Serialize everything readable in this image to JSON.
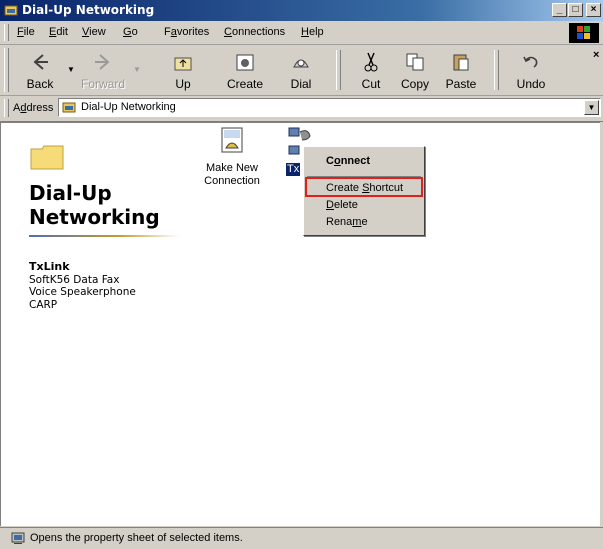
{
  "window": {
    "title": "Dial-Up Networking"
  },
  "title_buttons": {
    "minimize": "_",
    "maximize": "□",
    "close": "×"
  },
  "menubar": {
    "items": [
      {
        "label": "File",
        "accel": "F",
        "rest": "ile"
      },
      {
        "label": "Edit",
        "accel": "E",
        "rest": "dit"
      },
      {
        "label": "View",
        "accel": "V",
        "rest": "iew"
      },
      {
        "label": "Go",
        "accel": "G",
        "rest": "o"
      },
      {
        "label": "Favorites",
        "pre": "F",
        "accel": "a",
        "rest": "vorites"
      },
      {
        "label": "Connections",
        "accel": "C",
        "rest": "onnections"
      },
      {
        "label": "Help",
        "accel": "H",
        "rest": "elp"
      }
    ]
  },
  "toolbar": {
    "buttons": [
      {
        "label": "Back",
        "icon": "back-arrow-icon"
      },
      {
        "label": "Forward",
        "icon": "forward-arrow-icon"
      },
      {
        "label": "Up",
        "icon": "up-folder-icon"
      },
      {
        "label": "Create",
        "icon": "create-connection-icon"
      },
      {
        "label": "Dial",
        "icon": "dial-phone-icon"
      },
      {
        "label": "Cut",
        "icon": "scissors-icon"
      },
      {
        "label": "Copy",
        "icon": "copy-icon"
      },
      {
        "label": "Paste",
        "icon": "paste-icon"
      },
      {
        "label": "Undo",
        "icon": "undo-icon"
      }
    ],
    "close": "×"
  },
  "address": {
    "label_pre": "A",
    "label_accel": "d",
    "label_rest": "dress",
    "value": "Dial-Up Networking",
    "dropdown": "▼"
  },
  "left_panel": {
    "title_line1": "Dial-Up",
    "title_line2": "Networking",
    "details": {
      "name": "TxLink",
      "lines": [
        "SoftK56 Data Fax",
        "Voice Speakerphone",
        "CARP"
      ]
    }
  },
  "items": [
    {
      "label_line1": "Make New",
      "label_line2": "Connection",
      "icon": "make-new-connection-icon"
    },
    {
      "label": "Tx",
      "icon": "connection-computers-icon"
    }
  ],
  "context_menu": {
    "items": [
      {
        "label": "Connect",
        "accel": "o",
        "pre": "C",
        "rest": "nnect"
      },
      {
        "label": "Create Shortcut",
        "pre": "Create ",
        "accel": "S",
        "rest": "hortcut"
      },
      {
        "label": "Delete",
        "pre": "",
        "accel": "D",
        "rest": "elete"
      },
      {
        "label": "Rename",
        "pre": "Rena",
        "accel": "m",
        "rest": "e"
      }
    ]
  },
  "status": {
    "text": "Opens the property sheet of selected items."
  },
  "colors": {
    "titlebar_start": "#0a246a",
    "highlight_box": "#e0201c",
    "face": "#d4d0c8"
  }
}
